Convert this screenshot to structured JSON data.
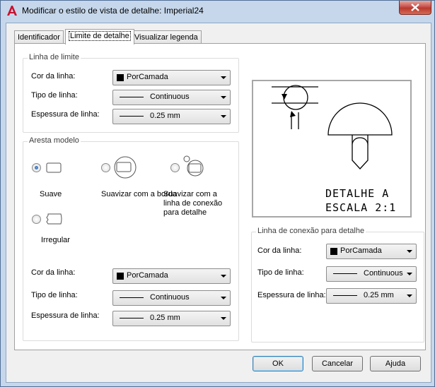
{
  "window": {
    "title": "Modificar o estilo de vista de detalhe: Imperial24"
  },
  "tabs": [
    {
      "label": "Identificador"
    },
    {
      "label": "Limite de detalhe"
    },
    {
      "label": "Visualizar legenda"
    }
  ],
  "boundary": {
    "group_title": "Linha de limite",
    "color_label": "Cor da linha:",
    "color_value": "PorCamada",
    "linetype_label": "Tipo de linha:",
    "linetype_value": "Continuous",
    "lineweight_label": "Espessura de linha:",
    "lineweight_value": "0.25 mm"
  },
  "model_edge": {
    "group_title": "Aresta modelo",
    "options": [
      {
        "label": "Suave",
        "selected": true
      },
      {
        "label": "Suavizar com a borda",
        "selected": false
      },
      {
        "label": "Suavizar com a linha de conexão para detalhe",
        "selected": false
      },
      {
        "label": "Irregular",
        "selected": false
      }
    ],
    "color_label": "Cor da linha:",
    "color_value": "PorCamada",
    "linetype_label": "Tipo de linha:",
    "linetype_value": "Continuous",
    "lineweight_label": "Espessura de linha:",
    "lineweight_value": "0.25 mm"
  },
  "preview": {
    "line1": "DETALHE A",
    "line2": "ESCALA 2:1"
  },
  "connection": {
    "group_title": "Linha de conexão para detalhe",
    "color_label": "Cor da linha:",
    "color_value": "PorCamada",
    "linetype_label": "Tipo de linha:",
    "linetype_value": "Continuous",
    "lineweight_label": "Espessura de linha:",
    "lineweight_value": "0.25 mm"
  },
  "buttons": {
    "ok": "OK",
    "cancel": "Cancelar",
    "help": "Ajuda"
  },
  "colors": {
    "accent": "#3c7fb1",
    "title_bg": "#c6d7eb",
    "close": "#c75050"
  }
}
